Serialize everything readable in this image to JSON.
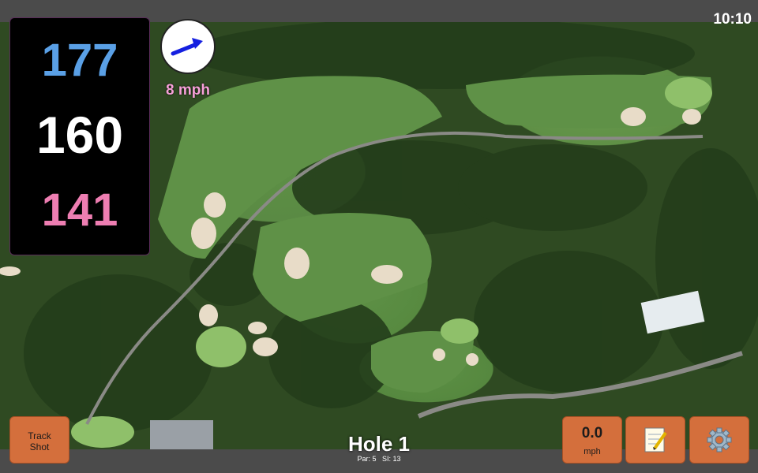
{
  "clock": "10:10",
  "yardage": {
    "back": "177",
    "middle": "160",
    "front": "141"
  },
  "wind": {
    "speed": "8 mph",
    "icon": "wind-arrow-icon"
  },
  "buttons": {
    "track_shot": "Track\nShot",
    "speed_value": "0.0",
    "speed_unit": "mph",
    "notes_icon": "notepad-icon",
    "settings_icon": "gear-icon"
  },
  "hole": {
    "title": "Hole 1",
    "par": "Par: 5",
    "si": "SI: 13"
  },
  "colors": {
    "button": "#d46f3c",
    "back_yd": "#5aa0e6",
    "front_yd": "#ee7eb2",
    "wind_text": "#f6a0d8"
  }
}
